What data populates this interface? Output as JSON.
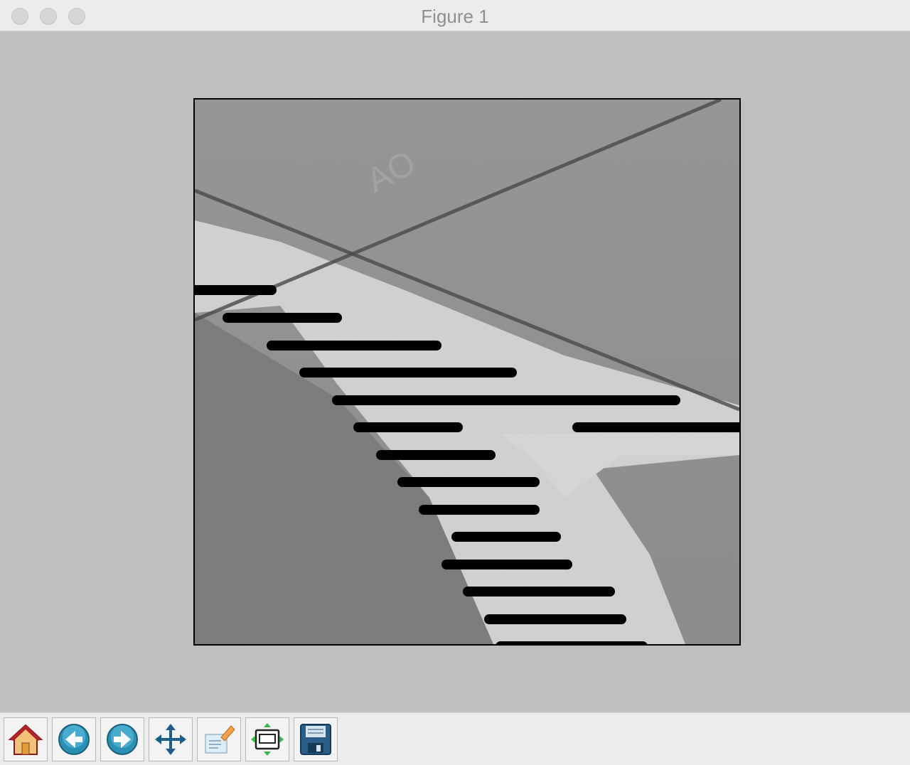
{
  "window": {
    "title": "Figure 1"
  },
  "toolbar": {
    "buttons": [
      {
        "name": "home",
        "icon": "home-icon"
      },
      {
        "name": "back",
        "icon": "back-arrow-icon"
      },
      {
        "name": "forward",
        "icon": "forward-arrow-icon"
      },
      {
        "name": "pan",
        "icon": "move-arrows-icon"
      },
      {
        "name": "zoom",
        "icon": "zoom-rect-icon"
      },
      {
        "name": "subplots",
        "icon": "subplot-config-icon"
      },
      {
        "name": "save",
        "icon": "floppy-disk-icon"
      }
    ]
  },
  "colors": {
    "window_bg": "#bfbfbf",
    "toolbar_bg": "#ececec",
    "stripe": "#000000",
    "paint": "#e8e8e8",
    "asphalt": "#8a8a8a"
  }
}
